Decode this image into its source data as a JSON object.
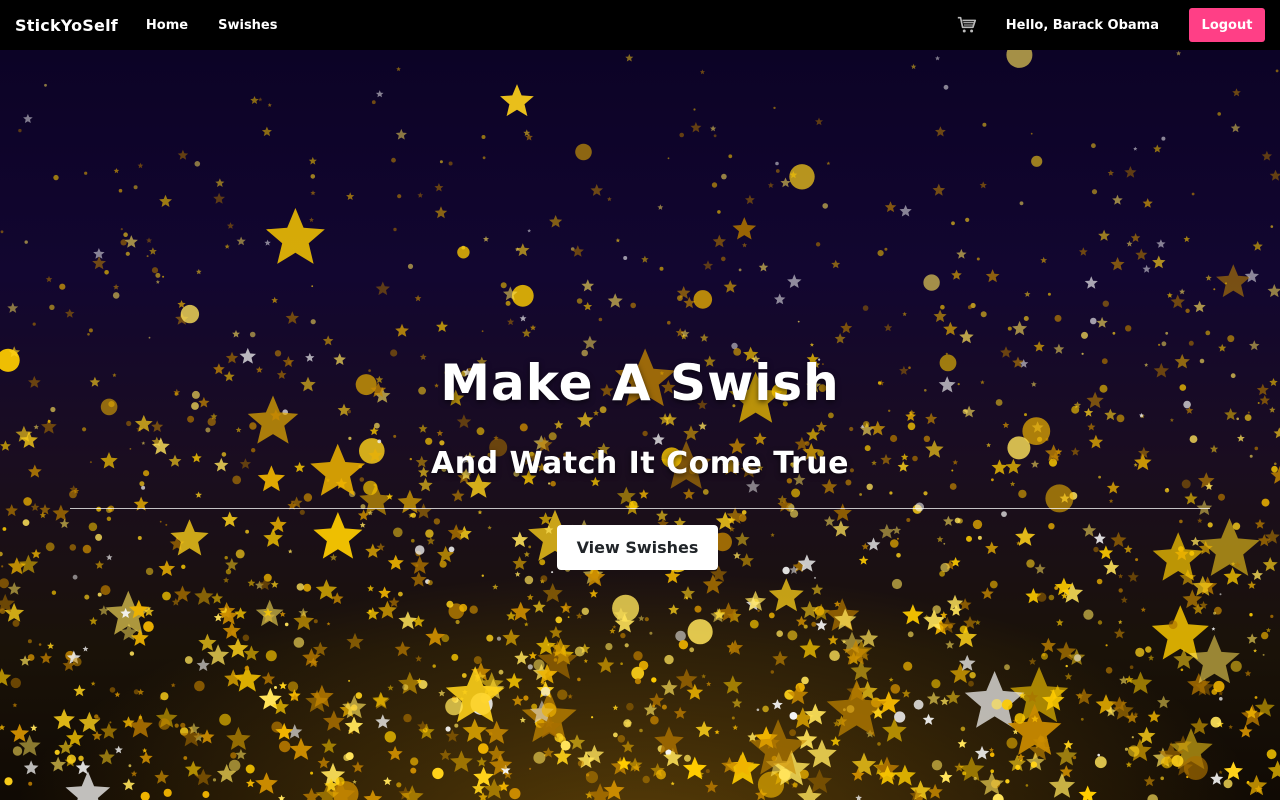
{
  "navbar": {
    "brand": "StickYoSelf",
    "links": [
      {
        "label": "Home"
      },
      {
        "label": "Swishes"
      }
    ],
    "cart_icon": "shopping-cart-icon",
    "greeting": "Hello, Barack Obama",
    "logout_label": "Logout",
    "logout_color": "#ff3f86"
  },
  "hero": {
    "title": "Make A Swish",
    "subtitle": "And Watch It Come True",
    "cta_label": "View Swishes",
    "background": "gold-stars-on-night-sky"
  }
}
